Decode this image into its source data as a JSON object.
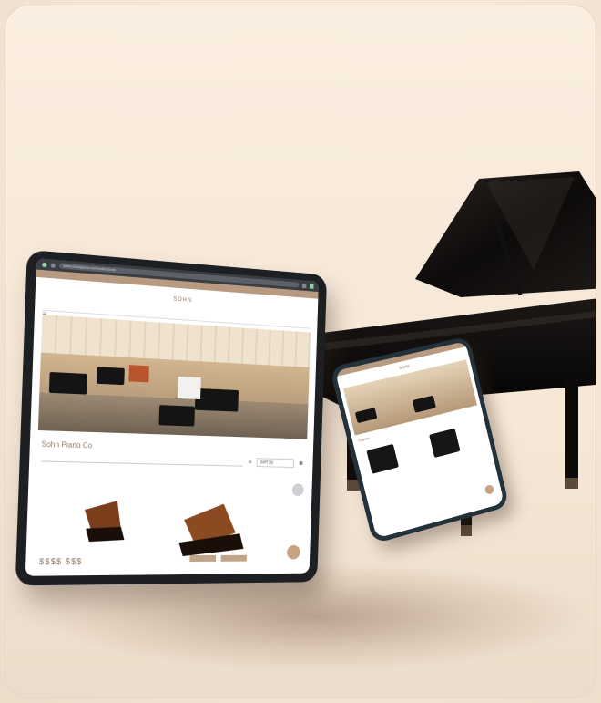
{
  "tablet": {
    "url": "www.sohnpiano.com/collections",
    "banner": "",
    "logo": "SOHN",
    "store_title": "Sohn Piano Co",
    "sort_label": "Sort by",
    "price": "$$$$ $$$",
    "buttons": [
      "",
      ""
    ]
  },
  "phone": {
    "logo": "SOHN",
    "section_title": "Pianos",
    "items": [
      {
        "caption": ""
      },
      {
        "caption": ""
      }
    ]
  }
}
